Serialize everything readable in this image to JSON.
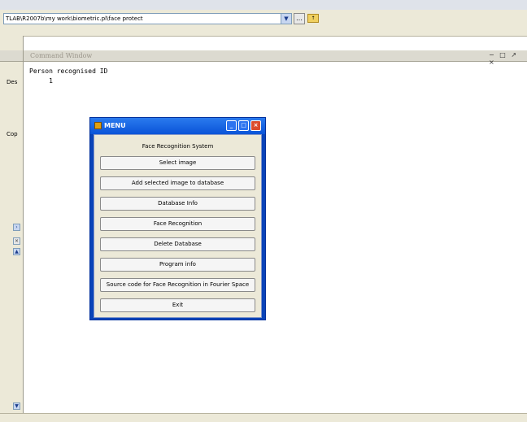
{
  "toolbar": {
    "current_folder_path": "TLAB\\R2007b\\my work\\biometric.pl\\face protect",
    "dropdown_icon": "chevron-down-icon",
    "browse_icon": "ellipsis-icon",
    "folder_icon": "folder-up-icon"
  },
  "left_panel": {
    "tab_label": "Des",
    "section_label": "Cop"
  },
  "command_window": {
    "title": "Command Window",
    "window_controls": "− □ ↗ ×",
    "lines": [
      "Person recognised ID",
      "     1"
    ]
  },
  "menu_dialog": {
    "title": "MENU",
    "heading": "Face Recognition System",
    "buttons": [
      "Select image",
      "Add selected image to database",
      "Database Info",
      "Face Recognition",
      "Delete Database",
      "Program info",
      "Source code for Face Recognition in Fourier Space",
      "Exit"
    ]
  }
}
